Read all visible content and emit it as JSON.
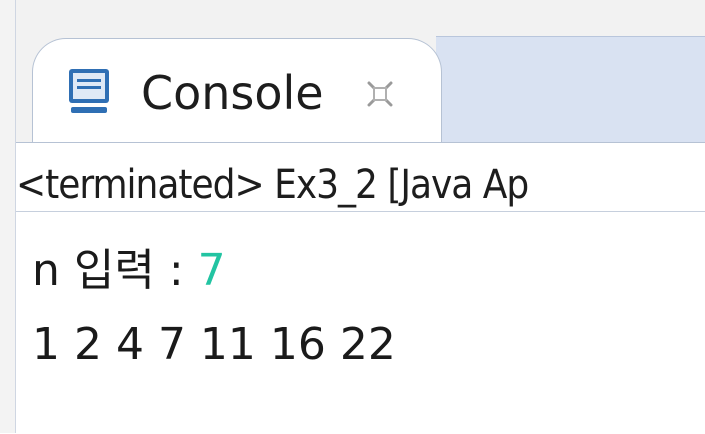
{
  "tab": {
    "title": "Console",
    "icon": "console-icon",
    "close_icon": "close-icon"
  },
  "status": {
    "text": "<terminated> Ex3_2 [Java Ap"
  },
  "output": {
    "prompt": "n  입력  :  ",
    "input_value": "7",
    "result": "1  2  4  7  11  16  22"
  },
  "colors": {
    "input_value": "#22c4a2",
    "tab_border": "#b6c2d4",
    "inactive_tab_area": "#d9e2f2",
    "icon_blue": "#2f6fb4"
  }
}
